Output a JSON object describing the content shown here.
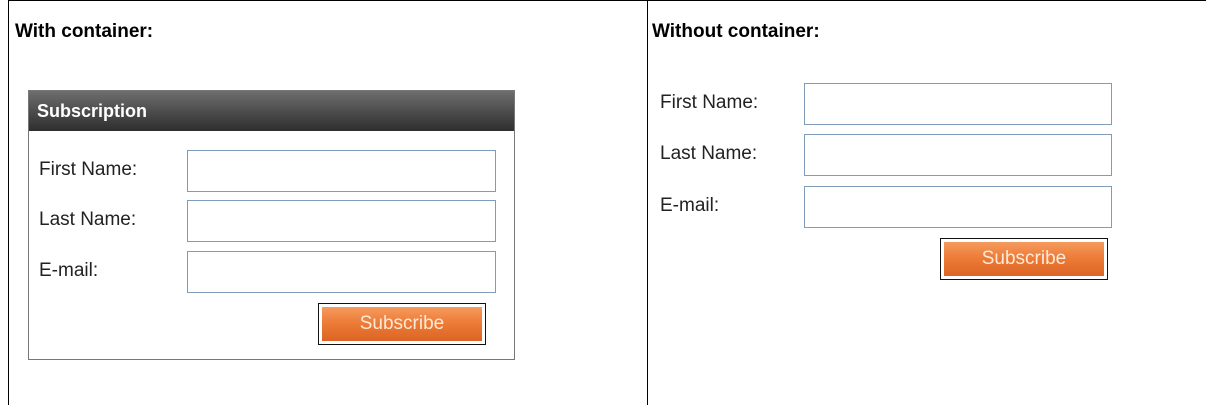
{
  "left_panel": {
    "heading": "With container:",
    "container_title": "Subscription",
    "form": {
      "first_name_label": "First Name:",
      "last_name_label": "Last Name:",
      "email_label": "E-mail:",
      "first_name_value": "",
      "last_name_value": "",
      "email_value": "",
      "subscribe_label": "Subscribe"
    }
  },
  "right_panel": {
    "heading": "Without container:",
    "form": {
      "first_name_label": "First Name:",
      "last_name_label": "Last Name:",
      "email_label": "E-mail:",
      "first_name_value": "",
      "last_name_value": "",
      "email_value": "",
      "subscribe_label": "Subscribe"
    }
  },
  "colors": {
    "button_orange": "#ec7a35",
    "container_header": "#4a4a4a",
    "input_border": "#7f9db9"
  }
}
